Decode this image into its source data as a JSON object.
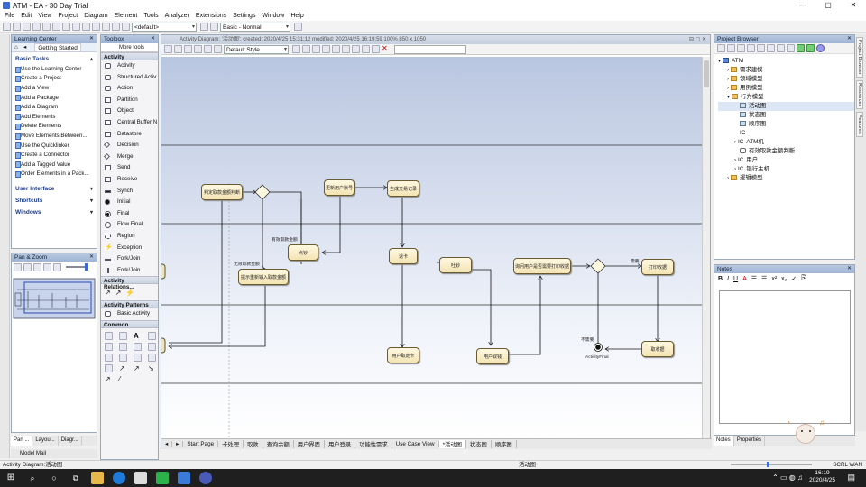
{
  "window": {
    "title": "ATM - EA - 30 Day Trial",
    "min": "—",
    "max": "▢",
    "close": "✕"
  },
  "menu": [
    "File",
    "Edit",
    "View",
    "Project",
    "Diagram",
    "Element",
    "Tools",
    "Analyzer",
    "Extensions",
    "Settings",
    "Window",
    "Help"
  ],
  "toolbar": {
    "perspective": "<default>",
    "workspace": "Basic - Normal"
  },
  "learning_center": {
    "title": "Learning Center",
    "tab": "Getting Started",
    "basic_tasks": "Basic Tasks",
    "tasks": [
      "Use the Learning Center",
      "Create a Project",
      "Add a View",
      "Add a Package",
      "Add a Diagram",
      "Add Elements",
      "Delete Elements",
      "Move Elements Between...",
      "Use the Quicklinker",
      "Create a Connector",
      "Add a Tagged Value",
      "Order Elements in a Pack..."
    ],
    "user_interface": "User Interface",
    "shortcuts": "Shortcuts",
    "windows": "Windows"
  },
  "pan_zoom": {
    "title": "Pan & Zoom"
  },
  "toolbox": {
    "title": "Toolbox",
    "search": "More tools",
    "groups": [
      {
        "name": "Activity",
        "items": [
          "Activity",
          "Structured Activ",
          "Action",
          "Partition",
          "Object",
          "Central Buffer N",
          "Datastore",
          "Decision",
          "Merge",
          "Send",
          "Receive",
          "Synch",
          "Initial",
          "Final",
          "Flow Final",
          "Region",
          "Exception",
          "Fork/Join",
          "Fork/Join"
        ]
      },
      {
        "name": "Activity Relations..."
      },
      {
        "name": "Activity Patterns",
        "items": [
          "Basic Activity"
        ]
      },
      {
        "name": "Common"
      }
    ]
  },
  "diagram": {
    "caption": "Activity Diagram: '活动图': created: 2020/4/25 15:31:12 modified: 2020/4/25 16:19:59 100% 850 x 1050",
    "style": "Default Style",
    "nodes": {
      "n1": "判定取款金额判断",
      "n2": "更新用户账号",
      "n3": "生成交易记录",
      "n4": "点钞",
      "n5": "提示重新输入取款金额",
      "n6": "退卡",
      "n7": "吐钞",
      "n8": "用户取走卡",
      "n9": "用户取钱",
      "n10": "询问用户是否需要打印收据",
      "n11": "打印收据",
      "n12": "取收据"
    },
    "guards": {
      "g1": "有效取款金额",
      "g2": "无效取款金额",
      "g3": "需要",
      "g4": "不需要"
    },
    "final_label": "ActivityFinal",
    "tabs": [
      "Start Page",
      "卡处理",
      "取款",
      "查询余额",
      "用户界面",
      "用户登录",
      "功能性需求",
      "Use Case View",
      "*活动图",
      "状态图",
      "顺序图"
    ]
  },
  "project_browser": {
    "title": "Project Browser",
    "tree": [
      {
        "label": "ATM",
        "level": 0
      },
      {
        "label": "需求建模",
        "level": 1
      },
      {
        "label": "领域模型",
        "level": 1
      },
      {
        "label": "用例模型",
        "level": 1
      },
      {
        "label": "行为模型",
        "level": 1
      },
      {
        "label": "活动图",
        "level": 2
      },
      {
        "label": "状态图",
        "level": 2
      },
      {
        "label": "顺序图",
        "level": 2
      },
      {
        "label": "IC",
        "level": 2
      },
      {
        "label": "ATM机",
        "level": 2
      },
      {
        "label": "有效取款金额判断",
        "level": 2
      },
      {
        "label": "用户",
        "level": 2
      },
      {
        "label": "银行主机",
        "level": 2
      },
      {
        "label": "逻辑模型",
        "level": 1
      }
    ]
  },
  "notes": {
    "title": "Notes",
    "tabs": [
      "Notes",
      "Properties"
    ]
  },
  "side_tabs": [
    "Project Browser",
    "Resources",
    "Features"
  ],
  "bottom_tabs": [
    "Pan ...",
    "Layou...",
    "Diagr..."
  ],
  "model_mail": "Model Mail",
  "status": {
    "left": "Activity Diagram:活动图",
    "center": "活动图",
    "right": "SCRL   WAN"
  },
  "clock": {
    "time": "16:19",
    "date": "2020/4/25"
  }
}
